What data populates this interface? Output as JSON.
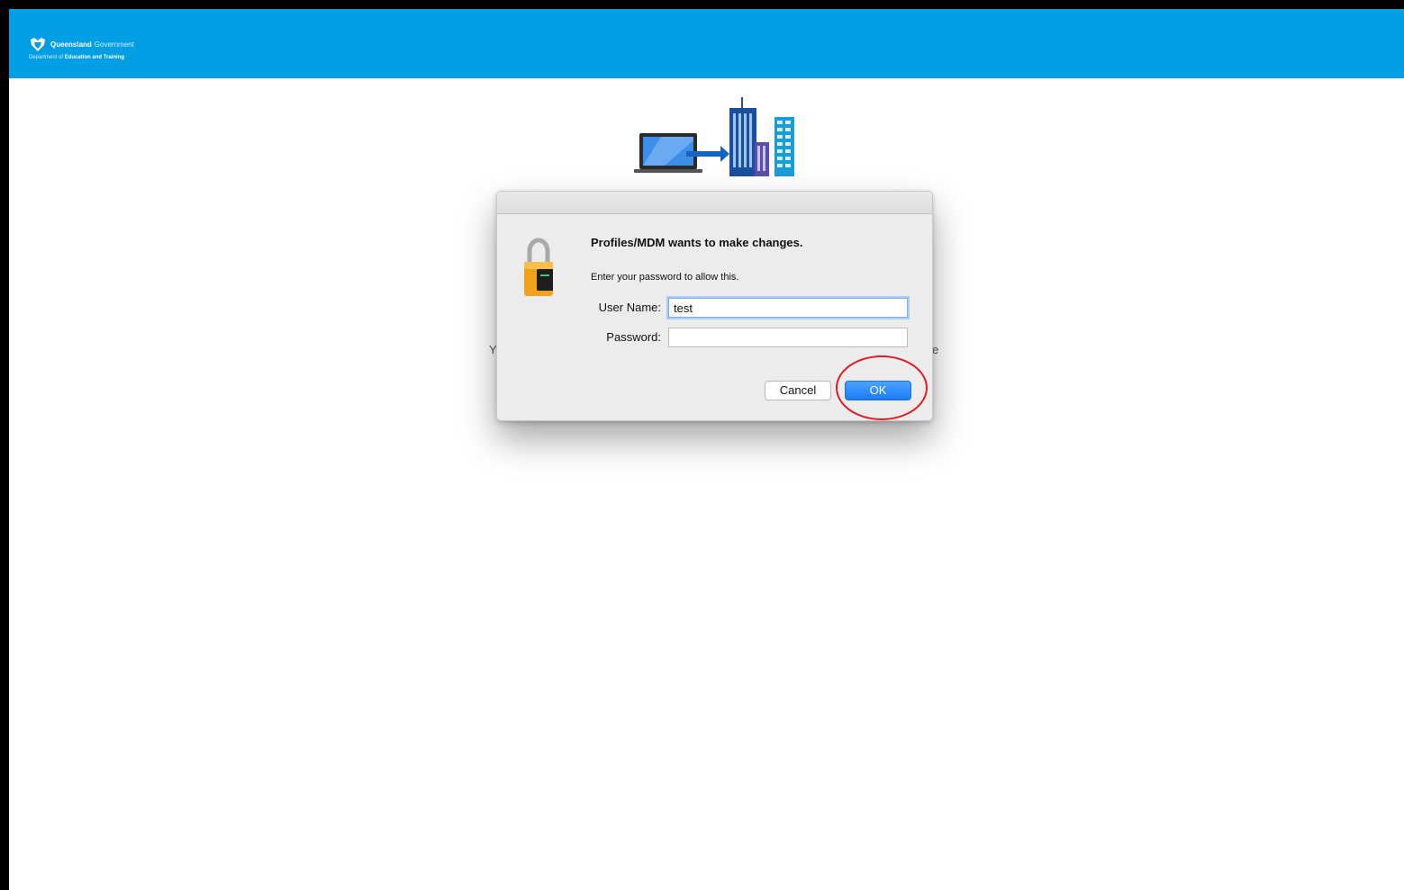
{
  "header": {
    "brand_name": "Queensland",
    "brand_government": "Government",
    "department_prefix": "Department of",
    "department_name": "Education and Training",
    "background_color": "#009fe3"
  },
  "illustration": {
    "icon": "laptop-to-buildings-icon"
  },
  "background_text": {
    "left_fragment": "Y",
    "right_fragment": "e"
  },
  "dialog": {
    "title": "Profiles/MDM wants to make changes.",
    "subtitle": "Enter your password to allow this.",
    "icon": "padlock-icon",
    "username_label": "User Name:",
    "username_value": "test",
    "password_label": "Password:",
    "password_value": "",
    "cancel_label": "Cancel",
    "ok_label": "OK",
    "ok_color": "#1a7cf4"
  },
  "annotation": {
    "highlight_color": "#e01b24",
    "highlight_target": "ok-button"
  }
}
